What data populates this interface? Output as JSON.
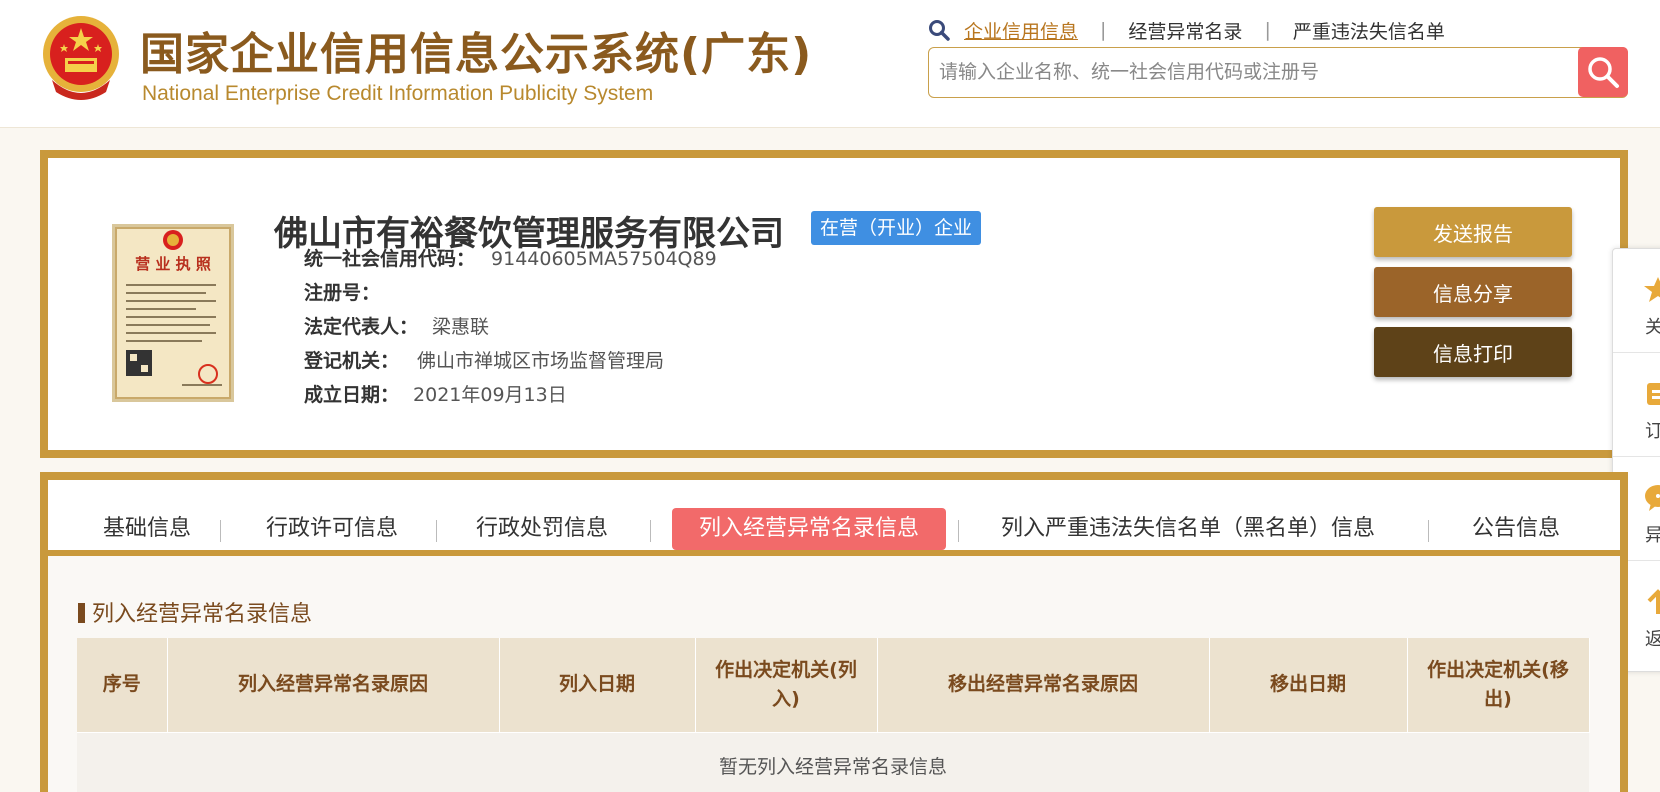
{
  "header": {
    "title_cn": "国家企业信用信息公示系统(广东)",
    "title_en": "National Enterprise Credit Information Publicity System",
    "nav": [
      {
        "label": "企业信用信息",
        "active": true
      },
      {
        "label": "经营异常名录",
        "active": false
      },
      {
        "label": "严重违法失信名单",
        "active": false
      }
    ],
    "search_placeholder": "请输入企业名称、统一社会信用代码或注册号"
  },
  "company": {
    "name": "佛山市有裕餐饮管理服务有限公司",
    "status": "在营（开业）企业",
    "fields": [
      {
        "label": "统一社会信用代码：",
        "value": "91440605MA57504Q89"
      },
      {
        "label": "注册号：",
        "value": ""
      },
      {
        "label": "法定代表人：",
        "value": "梁惠联"
      },
      {
        "label": "登记机关：",
        "value": "佛山市禅城区市场监督管理局"
      },
      {
        "label": "成立日期：",
        "value": "2021年09月13日"
      }
    ],
    "license_text": "营 业 执 照",
    "actions": {
      "send_report": "发送报告",
      "share": "信息分享",
      "print": "信息打印"
    }
  },
  "floating": [
    {
      "icon": "star-icon",
      "label": "关"
    },
    {
      "icon": "bookmark-icon",
      "label": "订"
    },
    {
      "icon": "chat-icon",
      "label": "异"
    },
    {
      "icon": "return-icon",
      "label": "返"
    }
  ],
  "tabs": [
    {
      "label": "基础信息",
      "active": false
    },
    {
      "label": "行政许可信息",
      "active": false
    },
    {
      "label": "行政处罚信息",
      "active": false
    },
    {
      "label": "列入经营异常名录信息",
      "active": true
    },
    {
      "label": "列入严重违法失信名单（黑名单）信息",
      "active": false
    },
    {
      "label": "公告信息",
      "active": false
    }
  ],
  "section": {
    "title": "列入经营异常名录信息",
    "columns": [
      "序号",
      "列入经营异常名录原因",
      "列入日期",
      "作出决定机关(列入)",
      "移出经营异常名录原因",
      "移出日期",
      "作出决定机关(移出)"
    ],
    "empty_text": "暂无列入经营异常名录信息"
  },
  "colors": {
    "gold_border": "#c9993c",
    "brown_title": "#8a5a1e",
    "active_tab": "#f26a6a",
    "status_blue": "#3f8fe2",
    "btn_send": "#c9993c",
    "btn_share": "#9b6429",
    "btn_print": "#5e4218"
  }
}
